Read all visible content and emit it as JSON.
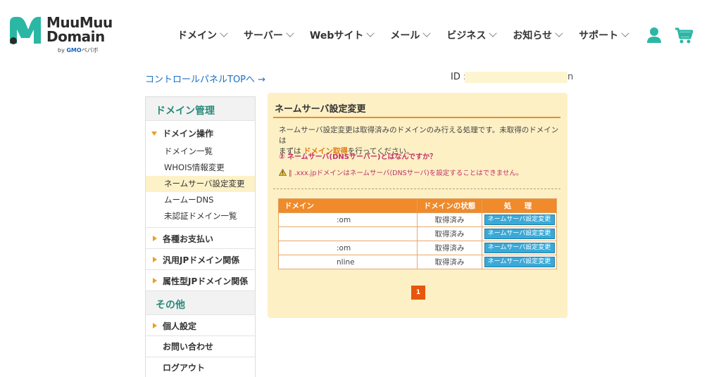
{
  "logo": {
    "line1": "MuuMuu",
    "line2": "Domain",
    "by": "by",
    "gmo": "GMO",
    "pepabo": "ペパボ",
    "colors": {
      "mark_teal": "#2bb7a4",
      "mark_dark": "#2b2b2b"
    }
  },
  "nav": {
    "items": [
      {
        "label": "ドメイン"
      },
      {
        "label": "サーバー"
      },
      {
        "label": "Webサイト"
      },
      {
        "label": "メール"
      },
      {
        "label": "ビジネス"
      },
      {
        "label": "お知らせ"
      },
      {
        "label": "サポート"
      }
    ],
    "user_icon": "user-icon",
    "cart_icon": "cart-icon"
  },
  "subheader": {
    "cp_link": "コントロールパネルTOPへ →",
    "id_label": "ID :",
    "id_tail": "n"
  },
  "sidebar": {
    "domain_head": "ドメイン管理",
    "domain_ops": "ドメイン操作",
    "domain_ops_items": [
      "ドメイン一覧",
      "WHOIS情報変更",
      "ネームサーバ設定変更",
      "ムームーDNS",
      "未認証ドメイン一覧"
    ],
    "payments": "各種お支払い",
    "jp_general": "汎用JPドメイン関係",
    "jp_type": "属性型JPドメイン関係",
    "other_head": "その他",
    "personal": "個人設定",
    "contact": "お問い合わせ",
    "logout": "ログアウト"
  },
  "panel": {
    "title": "ネームサーバ設定変更",
    "desc_1": "ネームサーバ設定変更は取得済みのドメインのみ行える処理です。未取得のドメインは",
    "desc_2a": "まずは",
    "desc_2b": "ドメイン取得",
    "desc_2c": "を行ってください。",
    "help": "② ネームサーバ(DNSサーバー)とはなんですか？",
    "warn": "‖ .xxx.jpドメインはネームサーバ(DNSサーバ)を設定することはできません。"
  },
  "table": {
    "headers": [
      "ドメイン",
      "ドメインの状態",
      "処　理"
    ],
    "rows": [
      {
        "domain": ":om",
        "status": "取得済み",
        "action": "ネームサーバ設定変更"
      },
      {
        "domain": "",
        "status": "取得済み",
        "action": "ネームサーバ設定変更"
      },
      {
        "domain": ":om",
        "status": "取得済み",
        "action": "ネームサーバ設定変更"
      },
      {
        "domain": "nline",
        "status": "取得済み",
        "action": "ネームサーバ設定変更"
      }
    ]
  },
  "pager": {
    "current": "1"
  }
}
